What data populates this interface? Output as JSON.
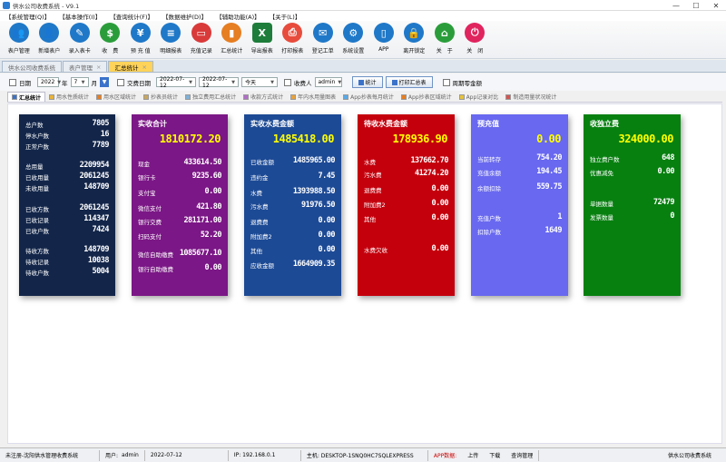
{
  "window": {
    "title": "供水公司收费系统 - V9.1",
    "min": "—",
    "max": "☐",
    "close": "✕"
  },
  "menu": [
    "【系统管理(Q)】",
    "【基本操作(I)】",
    "【查询统计(F)】",
    "【数据维护(D)】",
    "【辅助功能(A)】",
    "【关于(L)】"
  ],
  "toolbar": [
    {
      "label": "表户管理",
      "icon": "users-icon",
      "color": "#1f78c8",
      "glyph": "👥"
    },
    {
      "label": "新增表户",
      "icon": "add-user-icon",
      "color": "#1f78c8",
      "glyph": "👤"
    },
    {
      "label": "录入表卡",
      "icon": "edit-icon",
      "color": "#1f78c8",
      "glyph": "✎"
    },
    {
      "label": "收　费",
      "icon": "dollar-icon",
      "color": "#2a9d3a",
      "glyph": "$"
    },
    {
      "label": "预 充 值",
      "icon": "prepay-icon",
      "color": "#1f78c8",
      "glyph": "¥"
    },
    {
      "label": "明细报表",
      "icon": "report-icon",
      "color": "#1f78c8",
      "glyph": "≡"
    },
    {
      "label": "充值记录",
      "icon": "card-icon",
      "color": "#d93a3a",
      "glyph": "▭"
    },
    {
      "label": "汇总统计",
      "icon": "chart-icon",
      "color": "#e67e22",
      "glyph": "▮"
    },
    {
      "label": "导出报表",
      "icon": "excel-icon",
      "color": "#1e7d3a",
      "glyph": "X"
    },
    {
      "label": "打印报表",
      "icon": "print-icon",
      "color": "#e74c3c",
      "glyph": "⎙"
    },
    {
      "label": "登记工单",
      "icon": "workorder-icon",
      "color": "#1f78c8",
      "glyph": "✉"
    },
    {
      "label": "系统设置",
      "icon": "gear-icon",
      "color": "#1f78c8",
      "glyph": "⚙"
    },
    {
      "label": "APP",
      "icon": "phone-icon",
      "color": "#1f78c8",
      "glyph": "▯"
    },
    {
      "label": "离开锁定",
      "icon": "lock-icon",
      "color": "#1f78c8",
      "glyph": "🔒"
    },
    {
      "label": "关　于",
      "icon": "home-icon",
      "color": "#2a9d3a",
      "glyph": "⌂"
    },
    {
      "label": "关　闭",
      "icon": "power-icon",
      "color": "#e0245e",
      "glyph": "⏻"
    }
  ],
  "tabs1": [
    {
      "label": "供水公司收费系统",
      "active": false
    },
    {
      "label": "表户管理",
      "active": false
    },
    {
      "label": "汇总统计",
      "active": true
    }
  ],
  "filter": {
    "date_label": "日期",
    "year": "2022",
    "year_unit": "年",
    "month": "7",
    "month_unit": "月",
    "pay_date_label": "交费日期",
    "date_from": "2022-07-12",
    "date_to": "2022-07-12",
    "period": "今天",
    "collector_label": "收费人",
    "collector": "admin",
    "stat_button": "统计",
    "print_button": "打印汇总表",
    "all_label": "周期零金额"
  },
  "tabs2": [
    {
      "label": "汇总统计",
      "active": true
    },
    {
      "label": "用水性质统计"
    },
    {
      "label": "用水区域统计"
    },
    {
      "label": "抄表员统计"
    },
    {
      "label": "独立费用汇总统计"
    },
    {
      "label": "收款方式统计"
    },
    {
      "label": "年内水用量图表"
    },
    {
      "label": "App抄表每月统计"
    },
    {
      "label": "App抄表区域统计"
    },
    {
      "label": "App记录对比"
    },
    {
      "label": "制造用量状况统计"
    }
  ],
  "cards": {
    "c1": {
      "rows": [
        {
          "k": "总户数",
          "v": "7805"
        },
        {
          "k": "停水户数",
          "v": "16"
        },
        {
          "k": "正常户数",
          "v": "7789"
        },
        {
          "k": "总用量",
          "v": "2209954"
        },
        {
          "k": "已收用量",
          "v": "2061245"
        },
        {
          "k": "未收用量",
          "v": "148709"
        },
        {
          "k": "已收方数",
          "v": "2061245"
        },
        {
          "k": "已收记录",
          "v": "114347"
        },
        {
          "k": "已收户数",
          "v": "7424"
        },
        {
          "k": "待收方数",
          "v": "148709"
        },
        {
          "k": "待收记录",
          "v": "10038"
        },
        {
          "k": "待收户数",
          "v": "5004"
        }
      ]
    },
    "c2": {
      "title": "实收合计",
      "total": "1810172.20",
      "rows": [
        {
          "k": "现金",
          "v": "433614.50"
        },
        {
          "k": "银行卡",
          "v": "9235.60"
        },
        {
          "k": "支付宝",
          "v": "0.00"
        },
        {
          "k": "微信支付",
          "v": "421.80"
        },
        {
          "k": "银行交费",
          "v": "281171.00"
        },
        {
          "k": "扫码支付",
          "v": "52.20"
        },
        {
          "k": "微信自助缴费",
          "v": "1085677.10"
        },
        {
          "k": "银行自助缴费",
          "v": "0.00"
        }
      ]
    },
    "c3": {
      "title": "实收水费金额",
      "total": "1485418.00",
      "rows": [
        {
          "k": "已收金额",
          "v": "1485965.00"
        },
        {
          "k": "违约金",
          "v": "7.45"
        },
        {
          "k": "水费",
          "v": "1393988.50"
        },
        {
          "k": "污水费",
          "v": "91976.50"
        },
        {
          "k": "退费费",
          "v": "0.00"
        },
        {
          "k": "附加费2",
          "v": "0.00"
        },
        {
          "k": "其他",
          "v": "0.00"
        },
        {
          "k": "应收金额",
          "v": "1664909.35"
        }
      ]
    },
    "c4": {
      "title": "待收水费金额",
      "total": "178936.90",
      "rows": [
        {
          "k": "水费",
          "v": "137662.70"
        },
        {
          "k": "污水费",
          "v": "41274.20"
        },
        {
          "k": "退费费",
          "v": "0.00"
        },
        {
          "k": "附加费2",
          "v": "0.00"
        },
        {
          "k": "其他",
          "v": "0.00"
        },
        {
          "k": "水费欠收",
          "v": "0.00"
        }
      ]
    },
    "c5": {
      "title": "预充值",
      "total": "0.00",
      "rows": [
        {
          "k": "当前转存",
          "v": "754.20"
        },
        {
          "k": "充值余额",
          "v": "194.45"
        },
        {
          "k": "余额扣除",
          "v": "559.75"
        },
        {
          "k": "充值户数",
          "v": "1"
        },
        {
          "k": "扣除户数",
          "v": "1649"
        }
      ]
    },
    "c6": {
      "title": "收独立费",
      "total": "324000.00",
      "rows": [
        {
          "k": "独立费户数",
          "v": "648"
        },
        {
          "k": "优惠减免",
          "v": "0.00"
        },
        {
          "k": "单据数量",
          "v": "72479"
        },
        {
          "k": "发票数量",
          "v": "0"
        }
      ]
    }
  },
  "status": {
    "reg": "未注册-沈阳供水管理收费系统",
    "user_label": "用户:",
    "user": "admin",
    "date": "2022-07-12",
    "ip": "IP: 192.168.0.1",
    "host": "主机: DESKTOP-1SNQ0HC7SQLEXPRESS",
    "app_label": "APP数据:",
    "upload": "上传",
    "download": "下载",
    "query": "查询管理",
    "right": "供水公司收费系统"
  }
}
